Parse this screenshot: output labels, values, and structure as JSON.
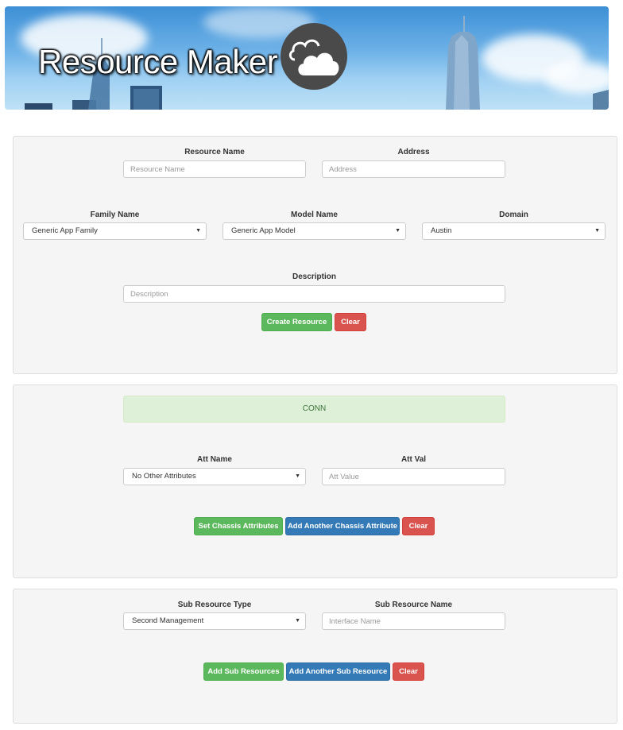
{
  "header": {
    "title": "Resource Maker",
    "logo_icon": "cloud-icon"
  },
  "resource_form": {
    "resource_name": {
      "label": "Resource Name",
      "placeholder": "Resource Name",
      "value": ""
    },
    "address": {
      "label": "Address",
      "placeholder": "Address",
      "value": ""
    },
    "family_name": {
      "label": "Family Name",
      "selected": "Generic App Family"
    },
    "model_name": {
      "label": "Model Name",
      "selected": "Generic App Model"
    },
    "domain": {
      "label": "Domain",
      "selected": "Austin"
    },
    "description": {
      "label": "Description",
      "placeholder": "Description",
      "value": ""
    },
    "create_button": "Create Resource",
    "clear_button": "Clear"
  },
  "attribute_form": {
    "alert_text": "CONN",
    "att_name": {
      "label": "Att Name",
      "selected": "No Other Attributes"
    },
    "att_val": {
      "label": "Att Val",
      "placeholder": "Att Value",
      "value": ""
    },
    "set_button": "Set Chassis Attributes",
    "add_another_button": "Add Another Chassis Attribute",
    "clear_button": "Clear"
  },
  "sub_resource_form": {
    "sub_resource_type": {
      "label": "Sub Resource Type",
      "selected": "Second Management"
    },
    "sub_resource_name": {
      "label": "Sub Resource Name",
      "placeholder": "Interface Name",
      "value": ""
    },
    "add_button": "Add Sub Resources",
    "add_another_button": "Add Another Sub Resource",
    "clear_button": "Clear"
  },
  "colors": {
    "success": "#5cb85c",
    "primary": "#337ab7",
    "danger": "#d9534f",
    "alert_bg": "#dff0d8",
    "alert_text": "#3c763d"
  }
}
